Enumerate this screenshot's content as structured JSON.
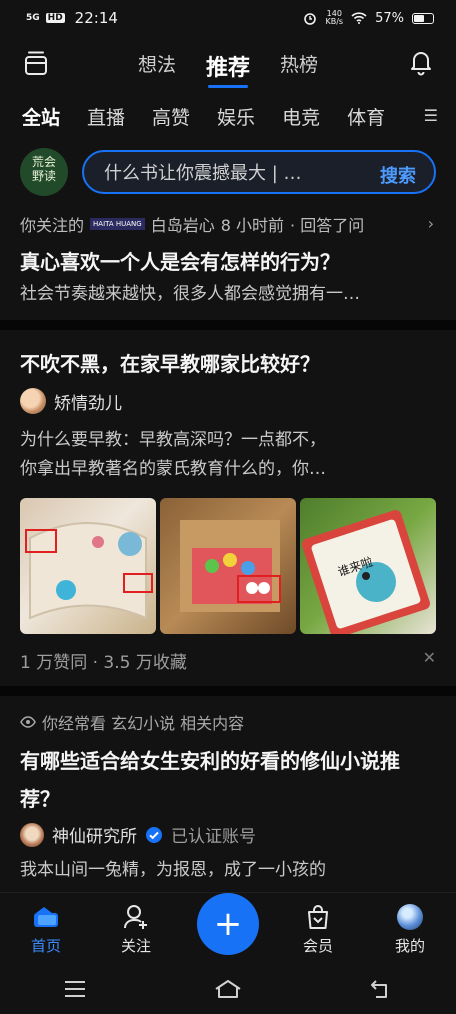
{
  "status": {
    "signal": "5G",
    "hd": "HD",
    "time": "22:14",
    "speed_value": "140",
    "speed_unit": "KB/s",
    "battery": "57%"
  },
  "topnav": {
    "tabs": [
      "想法",
      "推荐",
      "热榜"
    ]
  },
  "categories": [
    "全站",
    "直播",
    "高赞",
    "娱乐",
    "电竞",
    "体育"
  ],
  "search": {
    "logo_text_1": "荒会",
    "logo_text_2": "野读",
    "placeholder": "什么书让你震撼最大 | …",
    "button": "搜索"
  },
  "card1": {
    "meta_prefix": "你关注的",
    "badge": "HAITA HUANG",
    "author": "白岛岩心",
    "time": "8 小时前",
    "action": "· 回答了问",
    "title": "真心喜欢一个人是会有怎样的行为？",
    "excerpt": "社会节奏越来越快，很多人都会感觉拥有一…"
  },
  "card2": {
    "title": "不吹不黑，在家早教哪家比较好？",
    "author": "矫情劲儿",
    "excerpt_lines": [
      "为什么要早教：早教高深吗？一点都不，",
      "你拿出早教著名的蒙氏教育什么的，你…"
    ],
    "stats": "1 万赞同 · 3.5 万收藏",
    "image3_text": "谁来啦"
  },
  "card3": {
    "reason": "你经常看 玄幻小说 相关内容",
    "title": "有哪些适合给女生安利的好看的修仙小说推荐？",
    "author": "神仙研究所",
    "verified": "已认证账号",
    "excerpt": "我本山间一兔精，为报恩，成了一小孩的"
  },
  "bottom_tabs": [
    {
      "label": "首页"
    },
    {
      "label": "关注"
    },
    {
      "label": "会员"
    },
    {
      "label": "我的"
    }
  ],
  "colors": {
    "accent": "#1772f6",
    "background": "#121212"
  }
}
